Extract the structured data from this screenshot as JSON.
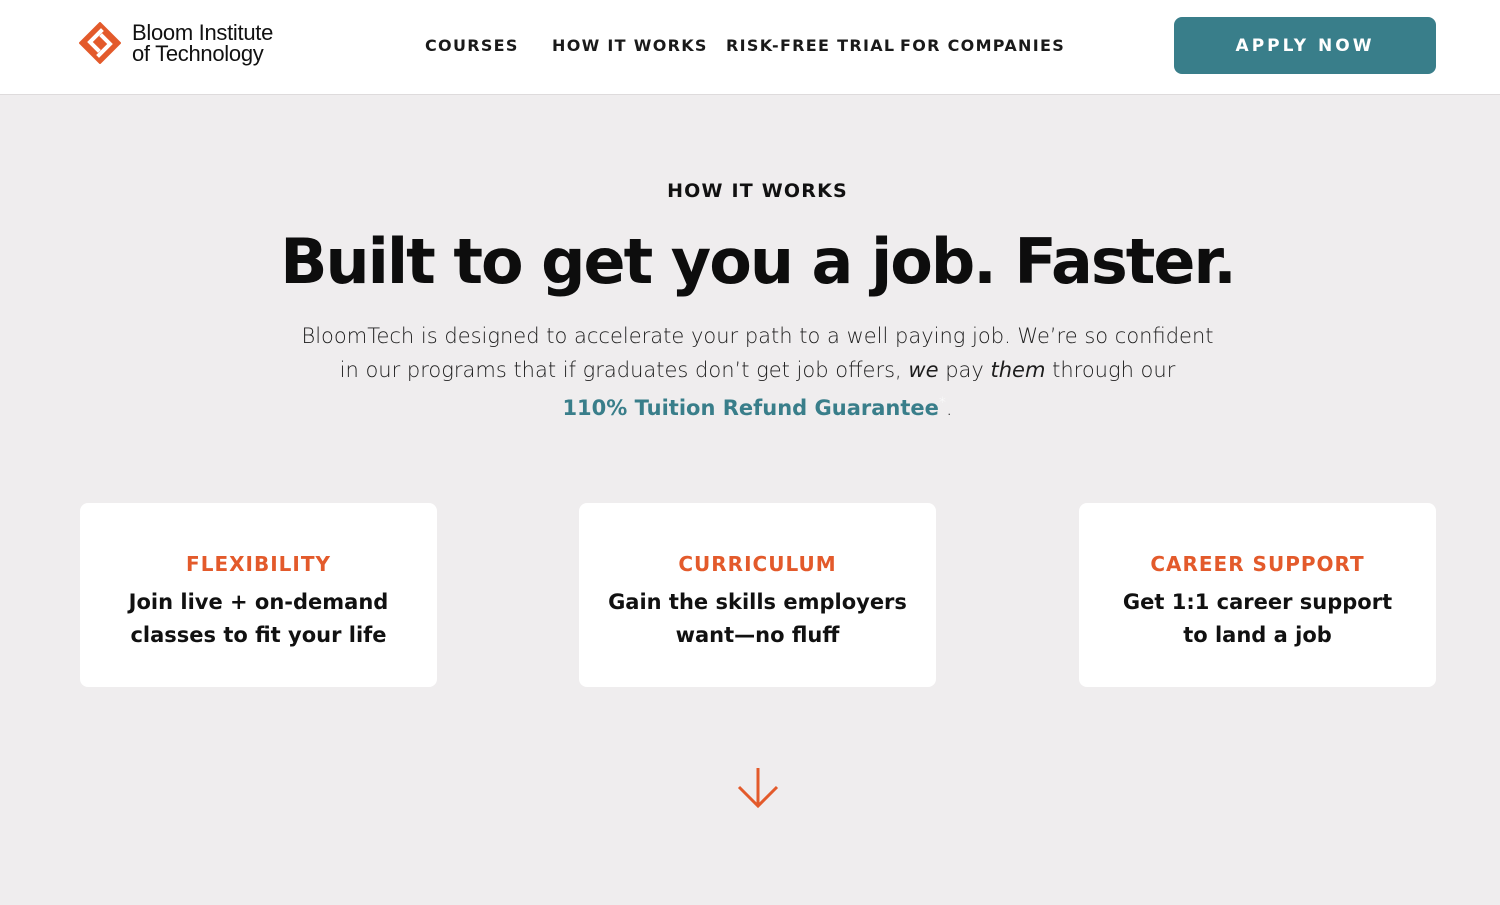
{
  "header": {
    "logo": {
      "icon": "bloomtech-logo-icon",
      "line1": "Bloom Institute",
      "line2": "of Technology"
    },
    "nav": [
      {
        "label": "COURSES"
      },
      {
        "label": "HOW IT WORKS"
      },
      {
        "label": "RISK-FREE TRIAL"
      },
      {
        "label": "FOR COMPANIES"
      }
    ],
    "apply_label": "APPLY NOW"
  },
  "hero": {
    "eyebrow": "HOW IT WORKS",
    "headline": "Built to get you a job. Faster.",
    "intro_part1": "BloomTech is designed to accelerate your path to a well paying job. We’re so confident in our programs that if graduates don’t get job offers, ",
    "intro_we": "we",
    "intro_pay": " pay ",
    "intro_them": "them",
    "intro_part2": " through our ",
    "guarantee_link": "110% Tuition Refund Guarantee",
    "asterisk": "*",
    "period": "."
  },
  "cards": [
    {
      "title": "FLEXIBILITY",
      "body": "Join live + on-demand classes to fit your life"
    },
    {
      "title": "CURRICULUM",
      "body": "Gain the skills employers want—no fluff"
    },
    {
      "title": "CAREER SUPPORT",
      "body": "Get 1:1 career support to land a job"
    }
  ],
  "scroll_icon": "arrow-down-icon",
  "colors": {
    "accent_teal": "#397e8a",
    "accent_orange": "#e35a2b",
    "background": "#efedee"
  }
}
